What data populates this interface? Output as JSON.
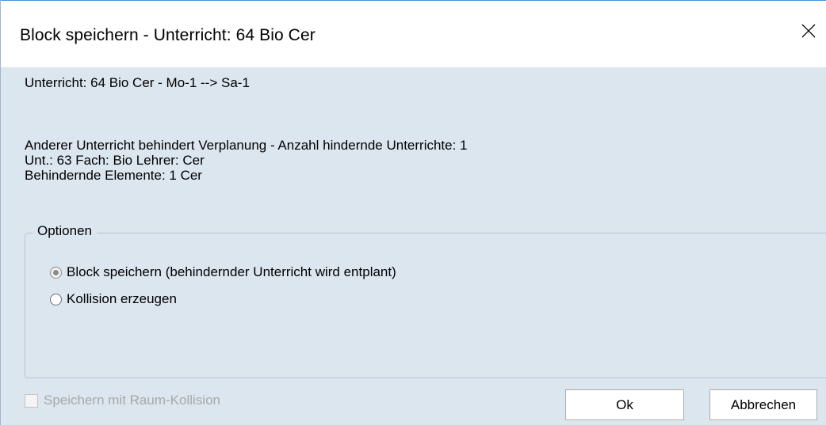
{
  "window": {
    "title": "Block speichern - Unterricht: 64 Bio Cer",
    "close_icon": "close-icon"
  },
  "info": {
    "line1": "Unterricht: 64 Bio Cer - Mo-1 --> Sa-1",
    "line2": "Anderer Unterricht behindert Verplanung - Anzahl hindernde Unterrichte: 1",
    "line3": "Unt.: 63 Fach: Bio Lehrer: Cer",
    "line4": "Behindernde Elemente: 1 Cer"
  },
  "options": {
    "legend": "Optionen",
    "items": [
      {
        "label": "Block speichern (behindernder Unterricht wird entplant)",
        "checked": true
      },
      {
        "label": "Kollision erzeugen",
        "checked": false
      }
    ]
  },
  "room_collision": {
    "label": "Speichern mit Raum-Kollision",
    "checked": false,
    "disabled": true
  },
  "buttons": {
    "ok": "Ok",
    "cancel": "Abbrechen"
  },
  "colors": {
    "dialog_background": "#dce6ef",
    "titlebar_background": "#ffffff",
    "disabled_text": "#a8a8a8"
  }
}
